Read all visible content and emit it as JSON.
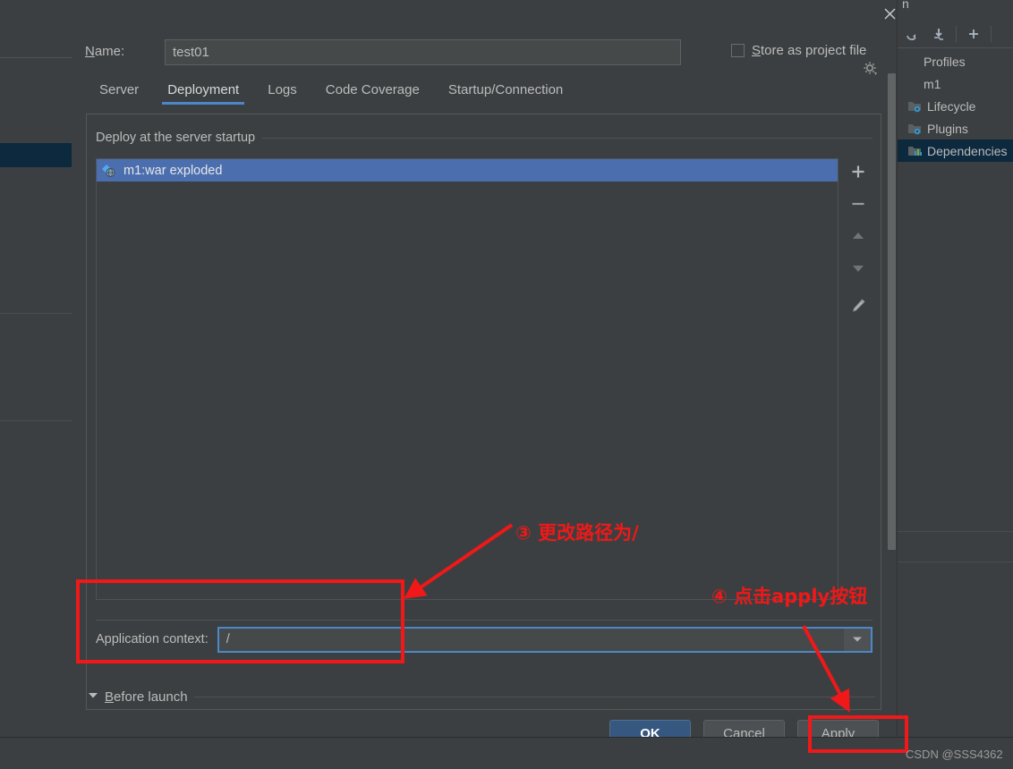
{
  "dialog": {
    "close_icon": "close-icon",
    "name_label": "Name:",
    "name_value": "test01",
    "store_as_project_file_label": "Store as project file",
    "gear_icon": "gear-icon",
    "tabs": [
      {
        "label": "Server",
        "active": false
      },
      {
        "label": "Deployment",
        "active": true
      },
      {
        "label": "Logs",
        "active": false
      },
      {
        "label": "Code Coverage",
        "active": false
      },
      {
        "label": "Startup/Connection",
        "active": false
      }
    ],
    "group_title": "Deploy at the server startup",
    "deploy_items": [
      {
        "label": "m1:war exploded",
        "icon": "war-artifact-icon",
        "selected": true
      }
    ],
    "list_toolbar": [
      {
        "name": "add-button",
        "glyph": "+"
      },
      {
        "name": "remove-button",
        "glyph": "−"
      },
      {
        "name": "move-up-button",
        "glyph": "▲"
      },
      {
        "name": "move-down-button",
        "glyph": "▼"
      },
      {
        "name": "edit-button",
        "glyph": "✎"
      }
    ],
    "application_context_label": "Application context:",
    "application_context_value": "/",
    "combo_arrow_icon": "chevron-down-icon",
    "before_launch_label": "Before launch",
    "buttons": {
      "ok": "OK",
      "cancel": "Cancel",
      "apply": "Apply"
    }
  },
  "maven_panel": {
    "title": "n",
    "toolbar": [
      {
        "name": "reimport-icon",
        "glyph": "↻"
      },
      {
        "name": "download-sources-icon",
        "glyph": "⤓"
      },
      {
        "name": "add-maven-project-icon",
        "glyph": "+"
      }
    ],
    "tree": [
      {
        "label": "Profiles",
        "icon": "",
        "selected": false,
        "indent": false
      },
      {
        "label": "m1",
        "icon": "",
        "selected": false,
        "indent": false
      },
      {
        "label": "Lifecycle",
        "icon": "folder-gear-icon",
        "selected": false,
        "indent": true
      },
      {
        "label": "Plugins",
        "icon": "folder-gear-icon",
        "selected": false,
        "indent": true
      },
      {
        "label": "Dependencies",
        "icon": "folder-chart-icon",
        "selected": true,
        "indent": true
      }
    ]
  },
  "annotations": [
    {
      "name": "annotation-step-3",
      "text": "③ 更改路径为/"
    },
    {
      "name": "annotation-step-4",
      "text": "④ 点击apply按钮"
    }
  ],
  "colors": {
    "accent": "#4a88c7",
    "selection": "#4b6eaf",
    "annotation_red": "#f01818",
    "primary_button": "#365880",
    "background": "#3c3f41"
  },
  "watermark": "CSDN @SSS4362"
}
